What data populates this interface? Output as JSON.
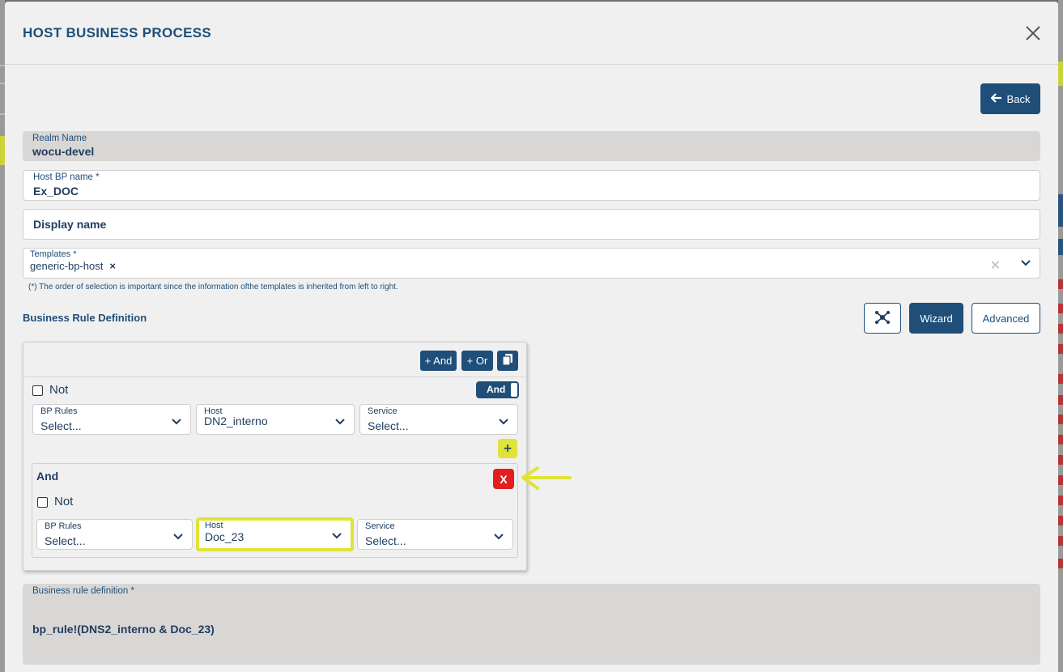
{
  "modal": {
    "title": "HOST BUSINESS PROCESS",
    "close_icon": "close-icon"
  },
  "back_button": {
    "label": "Back",
    "icon": "arrow-left-icon"
  },
  "form": {
    "realm": {
      "label": "Realm Name",
      "value": "wocu-devel"
    },
    "host_bp_name": {
      "label": "Host BP name *",
      "value": "Ex_DOC"
    },
    "display_name": {
      "label": "Display name",
      "value": ""
    },
    "templates": {
      "label": "Templates *",
      "selected": [
        "generic-bp-host"
      ],
      "clear_glyph": "✕",
      "remove_glyph": "×"
    },
    "templates_hint": "(*) The order of selection is important since the information ofthe templates is inherited from left to right."
  },
  "business_rule": {
    "section_title": "Business Rule Definition",
    "graph_button_icon": "network-graph-icon",
    "wizard_label": "Wizard",
    "advanced_label": "Advanced"
  },
  "builder": {
    "add_and_label": "+ And",
    "add_or_label": "+ Or",
    "copy_icon": "copy-icon",
    "not_label": "Not",
    "operator_toggle": "And",
    "row1": {
      "bp_rules": {
        "label": "BP Rules",
        "value": "Select..."
      },
      "host": {
        "label": "Host",
        "value": "DN2_interno"
      },
      "service": {
        "label": "Service",
        "value": "Select..."
      }
    },
    "add_row_label": "+",
    "group": {
      "title": "And",
      "remove_label": "X",
      "not_label": "Not",
      "bp_rules": {
        "label": "BP Rules",
        "value": "Select..."
      },
      "host": {
        "label": "Host",
        "value": "Doc_23"
      },
      "service": {
        "label": "Service",
        "value": "Select..."
      }
    }
  },
  "definition": {
    "label": "Business rule definition *",
    "value": "bp_rule!(DNS2_interno & Doc_23)"
  },
  "colors": {
    "primary": "#1f4e79",
    "highlight": "#dfe33a",
    "danger": "#e31e1e",
    "readonly_bg": "#d9d7d5"
  }
}
